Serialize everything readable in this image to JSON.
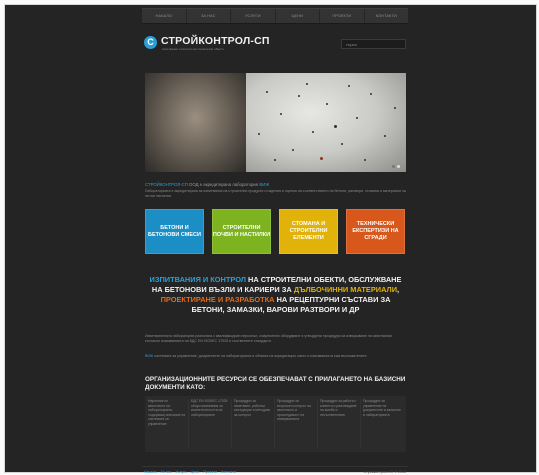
{
  "nav": {
    "items": [
      "НАЧАЛО",
      "ЗА НАС",
      "УСЛУГИ",
      "ЦЕНИ",
      "ПРОЕКТИ",
      "КОНТАКТИ"
    ]
  },
  "header": {
    "logo_mark": "С",
    "title": "СТРОЙКОНТРОЛ-СП",
    "tagline": "изпитвания и контрол на строителни обекти",
    "search_placeholder": "търси"
  },
  "intro": {
    "line1_prefix": "СТРОЙКОНТРОЛ-СП",
    "line1_text": " ООД е акредитирана лаборатория ",
    "line1_link": "ВИЖ",
    "line2": "Лабораторията е акредитирана за изпитвания на строителни продукти и изделия и оценка на съответствието на бетони, разтвори, стомана и материали за пътни настилки."
  },
  "tiles": [
    "БЕТОНИ И БЕТОНОВИ СМЕСИ",
    "СТРОИТЕЛНИ ПОЧВИ И НАСТИЛКИ",
    "СТОМАНА И СТРОИТЕЛНИ ЕЛЕМЕНТИ",
    "ТЕХНИЧЕСКИ ЕКСПЕРТИЗИ НА СГРАДИ"
  ],
  "headline": {
    "part1": "ИЗПИТВАНИЯ И КОНТРОЛ",
    "part2": " НА СТРОИТЕЛНИ ОБЕКТИ, ОБСЛУЖВАНЕ НА БЕТОНОВИ ВЪЗЛИ И КАРИЕРИ ЗА ",
    "part3": "ДЪЛБОЧИННИ МАТЕРИАЛИ",
    "part4": ", ",
    "part5": "ПРОЕКТИРАНЕ И РАЗРАБОТКА",
    "part6": " НА РЕЦЕПТУРНИ СЪСТАВИ ЗА БЕТОНИ, ЗАМАЗКИ, ВАРОВИ РАЗТВОРИ И ДР"
  },
  "body": {
    "paragraph1": "Изпитвателната лаборатория разполага с квалифициран персонал, съвременно оборудване и утвърдени процедури за извършване на изпитвания съгласно изискванията на БДС EN ISO/IEC 17025 и съответните стандарти.",
    "paragraph2_link": "ВИЖ",
    "paragraph2": " системата за управление, документите на лабораторията и обхвата на акредитация, както и изискванията към възложителите."
  },
  "org_heading": "ОРГАНИЗАЦИОННИТЕ РЕСУРСИ СЕ ОБЕЗПЕЧАВАТ С ПРИЛАГАНЕТО НА БАЗИСНИ ДОКУМЕНТИ КАТО:",
  "columns": [
    "Наръчник по качеството на лабораторията, съдържащ описание на системата за управление",
    "БДС EN ISO/IEC 17025 общи изисквания за компетентността на лабораториите",
    "Процедури за изпитване, работни инструкции и методики за контрол",
    "Процедури за вътрешен контрол на качеството и проследимост на измерванията",
    "Процедури за работа с клиенти и разглеждане на жалби и несъответствия",
    "Процедури за управление на документите и записите в лабораторията"
  ],
  "footer": {
    "links": [
      "Начало",
      "За нас",
      "Услуги",
      "Цени",
      "Проекти",
      "Контакти"
    ],
    "copyright": "Стройконтрол-СП © 2013"
  },
  "colors": {
    "accent_blue": "#2a9fd6",
    "tile_green": "#7cb31e",
    "tile_yellow": "#e0b20a",
    "tile_orange": "#d8571a",
    "background": "#242424"
  },
  "slider": {
    "active_dot": 2,
    "dot_count": 2
  }
}
